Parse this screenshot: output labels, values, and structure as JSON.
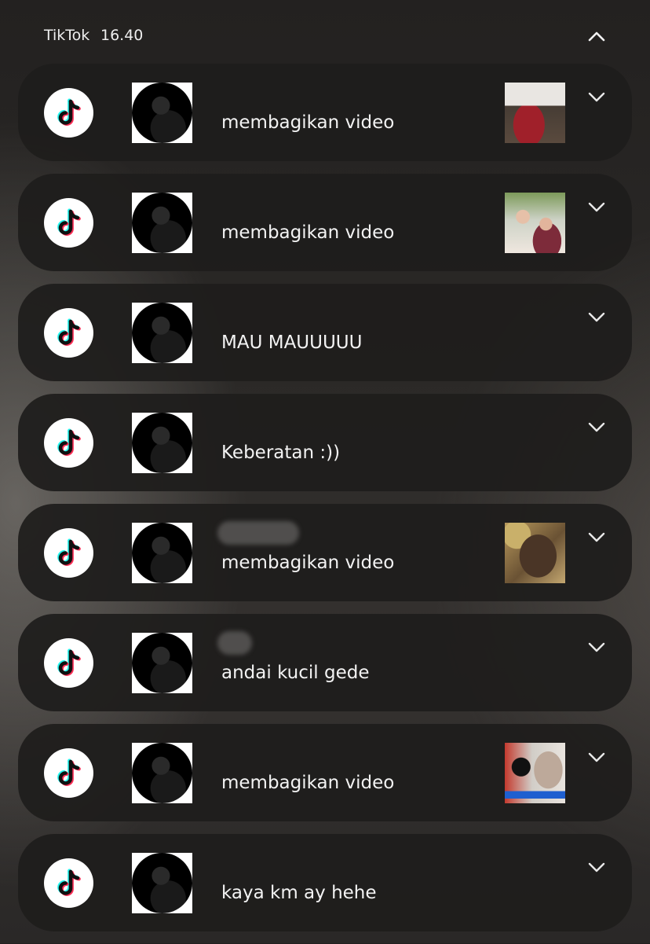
{
  "header": {
    "app_name": "TikTok",
    "time": "16.40",
    "collapse_icon": "chevron-up-icon"
  },
  "notifications": [
    {
      "sender": "",
      "message": "membagikan video",
      "has_thumbnail": true,
      "thumbnail_name": "video-thumbnail-1"
    },
    {
      "sender": "",
      "message": "membagikan video",
      "has_thumbnail": true,
      "thumbnail_name": "video-thumbnail-2"
    },
    {
      "sender": "",
      "message": "MAU MAUUUUU",
      "has_thumbnail": false
    },
    {
      "sender": "",
      "message": "Keberatan :))",
      "has_thumbnail": false
    },
    {
      "sender": "",
      "message": "membagikan video",
      "has_thumbnail": true,
      "thumbnail_name": "video-thumbnail-3"
    },
    {
      "sender": "",
      "message": "andai kucil gede",
      "has_thumbnail": false
    },
    {
      "sender": "",
      "message": "membagikan video",
      "has_thumbnail": true,
      "thumbnail_name": "video-thumbnail-4"
    },
    {
      "sender": "",
      "message": "kaya km ay hehe",
      "has_thumbnail": false
    }
  ],
  "icons": {
    "app": "tiktok-logo-icon",
    "expand": "chevron-down-icon"
  },
  "colors": {
    "card_background": "#1e1d1c",
    "app_icon_background": "#ffffff",
    "tiktok_cyan": "#25f4ee",
    "tiktok_red": "#fe2c55",
    "tiktok_black": "#111111"
  }
}
